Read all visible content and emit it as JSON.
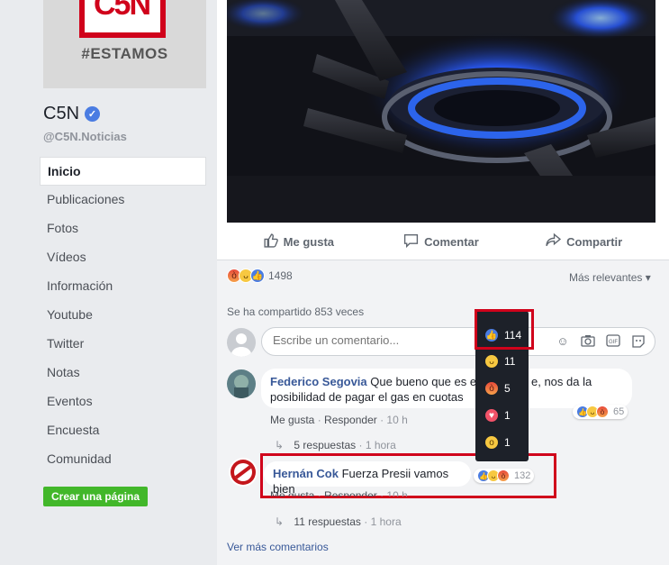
{
  "page": {
    "cover_logo_text": "C5N",
    "cover_tagline": "#ESTAMOS",
    "name": "C5N",
    "verified_mark": "✓",
    "handle": "@C5N.Noticias",
    "create_page_label": "Crear una página"
  },
  "nav": {
    "items": [
      {
        "label": "Inicio",
        "active": true
      },
      {
        "label": "Publicaciones"
      },
      {
        "label": "Fotos"
      },
      {
        "label": "Vídeos"
      },
      {
        "label": "Información"
      },
      {
        "label": "Youtube"
      },
      {
        "label": "Twitter"
      },
      {
        "label": "Notas"
      },
      {
        "label": "Eventos"
      },
      {
        "label": "Encuesta"
      },
      {
        "label": "Comunidad"
      }
    ]
  },
  "post": {
    "photo_description_icon": "gas-stove-flame-image",
    "actions": {
      "like": "Me gusta",
      "comment": "Comentar",
      "share": "Compartir"
    },
    "reaction_count": "1498",
    "sort_label": "Más relevantes ▾",
    "shared_text": "Se ha compartido 853 veces",
    "composer_placeholder": "Escribe un comentario...",
    "composer_icons": [
      "emoji-icon",
      "camera-icon",
      "gif-icon",
      "sticker-icon"
    ]
  },
  "comments": [
    {
      "author": "Federico Segovia",
      "text": "Que bueno que es el gobierno actual, nos da la",
      "text_line2": "posibilidad de pagar el gas en cuotas",
      "visible_part": "Que bueno que es el",
      "visible_tail": "e, nos da la",
      "like": "Me gusta",
      "reply": "Responder",
      "time": "10 h",
      "reaction_count": "65",
      "replies": "5 respuestas",
      "replies_time": "1 hora"
    },
    {
      "author": "Hernán Cok",
      "text": "Fuerza Presii vamos bien",
      "like": "Me gusta",
      "reply": "Responder",
      "time": "10 h",
      "reaction_count": "132",
      "replies": "11 respuestas",
      "replies_time": "1 hora"
    }
  ],
  "reaction_popup": [
    {
      "icon": "like-icon",
      "count": "114"
    },
    {
      "icon": "haha-icon",
      "count": "11"
    },
    {
      "icon": "angry-icon",
      "count": "5"
    },
    {
      "icon": "love-icon",
      "count": "1"
    },
    {
      "icon": "wow-icon",
      "count": "1"
    }
  ],
  "more_comments": "Ver más comentarios",
  "colors": {
    "facebook_blue": "#4a7ce2",
    "highlight_red": "#d0021b",
    "create_green": "#42b72a"
  }
}
